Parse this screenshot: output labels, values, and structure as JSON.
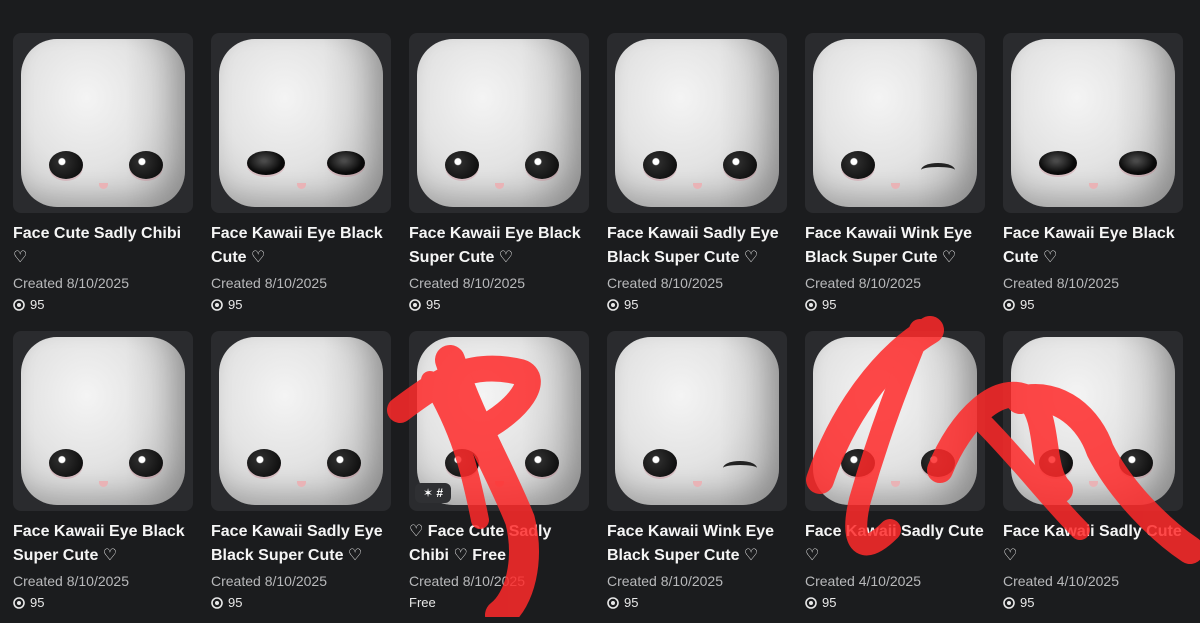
{
  "items": [
    {
      "title": "Face Cute Sadly Chibi ♡",
      "created": "Created 8/10/2025",
      "price": "95",
      "eyes": "round"
    },
    {
      "title": "Face Kawaii Eye Black Cute ♡",
      "created": "Created 8/10/2025",
      "price": "95",
      "eyes": "oval"
    },
    {
      "title": "Face Kawaii Eye Black Super Cute ♡",
      "created": "Created 8/10/2025",
      "price": "95",
      "eyes": "round"
    },
    {
      "title": "Face Kawaii Sadly Eye Black Super Cute ♡",
      "created": "Created 8/10/2025",
      "price": "95",
      "eyes": "round"
    },
    {
      "title": "Face Kawaii Wink Eye Black Super Cute ♡",
      "created": "Created 8/10/2025",
      "price": "95",
      "eyes": "wink"
    },
    {
      "title": "Face Kawaii Eye Black Cute ♡",
      "created": "Created 8/10/2025",
      "price": "95",
      "eyes": "oval"
    },
    {
      "title": "Face Kawaii Eye Black Super Cute ♡",
      "created": "Created 8/10/2025",
      "price": "95",
      "eyes": "round"
    },
    {
      "title": "Face Kawaii Sadly Eye Black Super Cute ♡",
      "created": "Created 8/10/2025",
      "price": "95",
      "eyes": "round"
    },
    {
      "title": "♡ Face Cute Sadly Chibi ♡ Free",
      "created": "Created 8/10/2025",
      "price": "Free",
      "eyes": "round",
      "badge": "✶ #"
    },
    {
      "title": "Face Kawaii Wink Eye Black Super Cute ♡",
      "created": "Created 8/10/2025",
      "price": "95",
      "eyes": "wink"
    },
    {
      "title": "Face Kawaii Sadly Cute ♡",
      "created": "Created 4/10/2025",
      "price": "95",
      "eyes": "round"
    },
    {
      "title": "Face Kawaii Sadly Cute ♡",
      "created": "Created 4/10/2025",
      "price": "95",
      "eyes": "round"
    }
  ],
  "icons": {
    "price": "robux-icon"
  },
  "colors": {
    "background": "#1b1c1e",
    "card_thumb": "#2a2b2e",
    "scribble": "#ff2a2a"
  }
}
